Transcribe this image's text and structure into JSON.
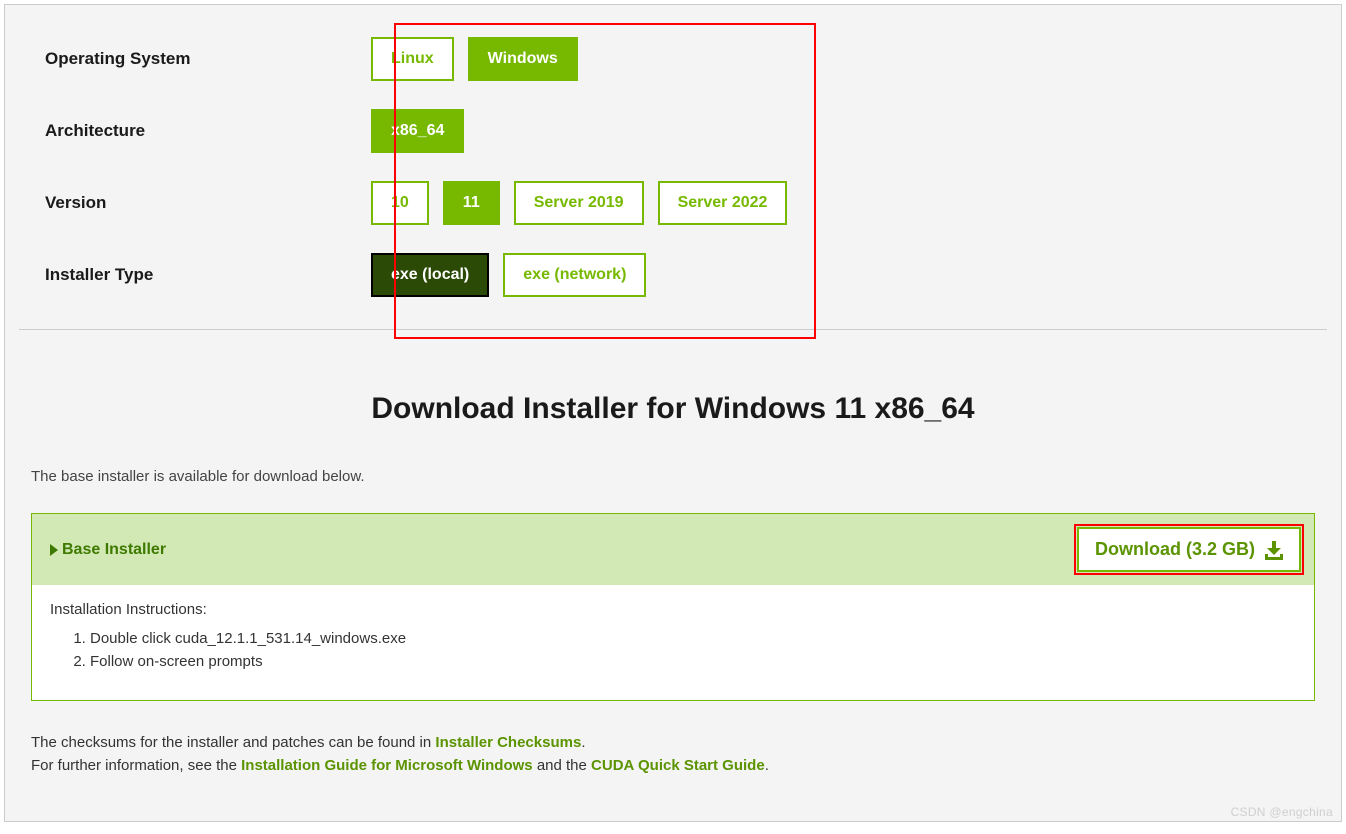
{
  "selectors": {
    "os": {
      "label": "Operating System",
      "options": [
        "Linux",
        "Windows"
      ],
      "selected": 1
    },
    "arch": {
      "label": "Architecture",
      "options": [
        "x86_64"
      ],
      "selected": 0
    },
    "version": {
      "label": "Version",
      "options": [
        "10",
        "11",
        "Server 2019",
        "Server 2022"
      ],
      "selected": 1
    },
    "installer": {
      "label": "Installer Type",
      "options": [
        "exe (local)",
        "exe (network)"
      ],
      "selected": 0,
      "selected_style": "dark"
    }
  },
  "download": {
    "title": "Download Installer for Windows 11 x86_64",
    "available_text": "The base installer is available for download below.",
    "base_installer_label": "Base Installer",
    "button_label": "Download (3.2 GB)",
    "instructions_title": "Installation Instructions:",
    "steps": [
      "Double click cuda_12.1.1_531.14_windows.exe",
      "Follow on-screen prompts"
    ]
  },
  "footnotes": {
    "checksums_pre": "The checksums for the installer and patches can be found in ",
    "checksums_link": "Installer Checksums",
    "checksums_post": ".",
    "further_pre": "For further information, see the ",
    "guide_windows_link": "Installation Guide for Microsoft Windows",
    "mid": " and the ",
    "quickstart_link": "CUDA Quick Start Guide",
    "further_post": "."
  },
  "watermark": "CSDN @engchina"
}
